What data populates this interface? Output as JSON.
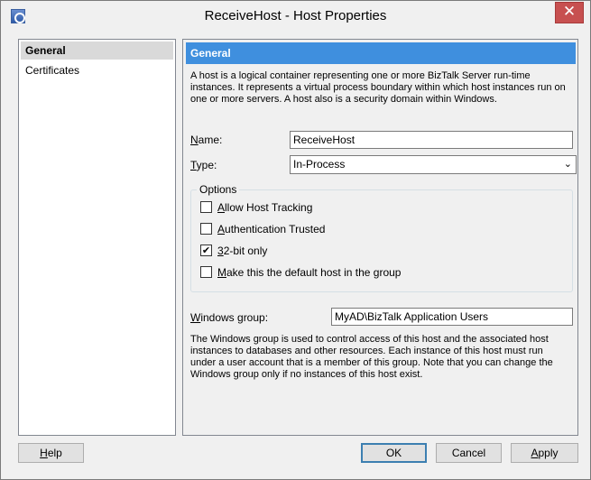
{
  "window": {
    "title": "ReceiveHost - Host Properties",
    "close_glyph": "✕"
  },
  "nav": {
    "items": [
      {
        "label": "General",
        "selected": true
      },
      {
        "label": "Certificates",
        "selected": false
      }
    ]
  },
  "panel": {
    "header": "General",
    "intro": "A host is a logical container representing one or more BizTalk Server run-time instances. It represents a virtual process boundary within which host instances run on one or more servers. A host also is a security domain within Windows.",
    "name_label_first": "N",
    "name_label_rest": "ame:",
    "name_value": "ReceiveHost",
    "type_label_first": "T",
    "type_label_rest": "ype:",
    "type_value": "In-Process",
    "options_title": "Options",
    "options": [
      {
        "accel": "A",
        "rest": "llow Host Tracking",
        "checked": false
      },
      {
        "accel": "A",
        "rest": "uthentication Trusted",
        "checked": false
      },
      {
        "accel": "3",
        "rest": "2-bit only",
        "checked": true
      },
      {
        "accel": "M",
        "rest": "ake this the default host in the group",
        "checked": false
      }
    ],
    "windows_group_label_first": "W",
    "windows_group_label_rest": "indows group:",
    "windows_group_value": "MyAD\\BizTalk Application Users",
    "windows_group_desc": "The Windows group is used to control access of this host and the associated host instances to databases and other resources. Each instance of this host must run under a user account that is a member of this group. Note that you can change the Windows group only if no instances of this host exist."
  },
  "buttons": {
    "help_first": "H",
    "help_rest": "elp",
    "ok": "OK",
    "cancel": "Cancel",
    "apply_first": "A",
    "apply_rest": "pply"
  },
  "icons": {
    "chevron": "⌄",
    "check": "✔"
  },
  "colors": {
    "header_blue": "#3f8fde",
    "close_red": "#c75050",
    "selected_nav": "#d9d9d9"
  }
}
